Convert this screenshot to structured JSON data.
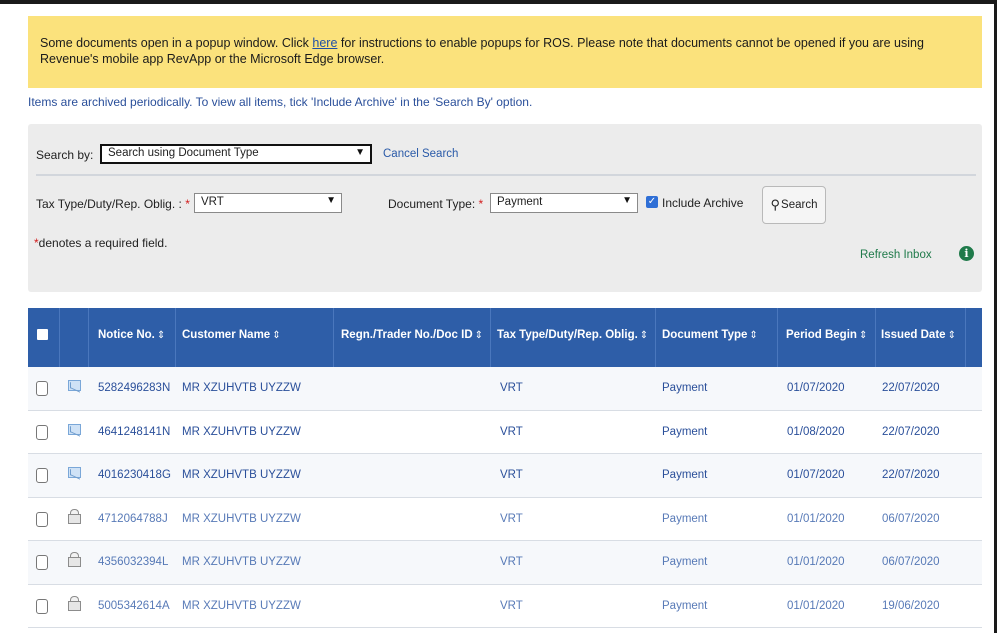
{
  "notice": {
    "line1_prefix": "Some documents open in a popup window. Click ",
    "link": "here",
    "line1_suffix": " for instructions to enable popups for ROS. Please note that documents cannot be opened if you are using",
    "line2": "Revenue's mobile app RevApp or the Microsoft Edge browser."
  },
  "archive_note": "Items are archived periodically. To view all items, tick 'Include Archive' in the 'Search By' option.",
  "search": {
    "search_by_label": "Search by:",
    "search_by_value": "Search using Document Type",
    "cancel_label": "Cancel Search",
    "tax_type_label": "Tax Type/Duty/Rep. Oblig. :",
    "required_mark": "*",
    "tax_type_value": "VRT",
    "doc_type_label": "Document Type:",
    "doc_type_value": "Payment",
    "include_archive_label": "Include Archive",
    "include_archive_checked": true,
    "search_button_label": "Search",
    "required_note": "denotes a required field.",
    "refresh_label": "Refresh Inbox"
  },
  "table": {
    "columns": [
      "Notice No.",
      "Customer Name",
      "Regn./Trader No./Doc ID",
      "Tax Type/Duty/Rep. Oblig.",
      "Document Type",
      "Period Begin",
      "Issued Date"
    ],
    "rows": [
      {
        "status": "unread",
        "notice": "5282496283N",
        "customer": "MR XZUHVTB UYZZW",
        "regn": "",
        "tax": "VRT",
        "doc": "Payment",
        "period": "01/07/2020",
        "issued": "22/07/2020"
      },
      {
        "status": "unread",
        "notice": "4641248141N",
        "customer": "MR XZUHVTB UYZZW",
        "regn": "",
        "tax": "VRT",
        "doc": "Payment",
        "period": "01/08/2020",
        "issued": "22/07/2020"
      },
      {
        "status": "unread",
        "notice": "4016230418G",
        "customer": "MR XZUHVTB UYZZW",
        "regn": "",
        "tax": "VRT",
        "doc": "Payment",
        "period": "01/07/2020",
        "issued": "22/07/2020"
      },
      {
        "status": "read",
        "notice": "4712064788J",
        "customer": "MR XZUHVTB UYZZW",
        "regn": "",
        "tax": "VRT",
        "doc": "Payment",
        "period": "01/01/2020",
        "issued": "06/07/2020"
      },
      {
        "status": "read",
        "notice": "4356032394L",
        "customer": "MR XZUHVTB UYZZW",
        "regn": "",
        "tax": "VRT",
        "doc": "Payment",
        "period": "01/01/2020",
        "issued": "06/07/2020"
      },
      {
        "status": "read",
        "notice": "5005342614A",
        "customer": "MR XZUHVTB UYZZW",
        "regn": "",
        "tax": "VRT",
        "doc": "Payment",
        "period": "01/01/2020",
        "issued": "19/06/2020"
      }
    ]
  },
  "colors": {
    "notice_bg": "#fbe27c",
    "header_bg": "#2e5ea8",
    "link": "#2a5aa8",
    "panel_bg": "#ececec"
  },
  "icons": {
    "unread": "envelope-icon",
    "read": "open-envelope-icon",
    "sort": "sort-icon",
    "info": "info-icon",
    "search": "magnifier-icon",
    "dropdown": "chevron-down-icon"
  }
}
